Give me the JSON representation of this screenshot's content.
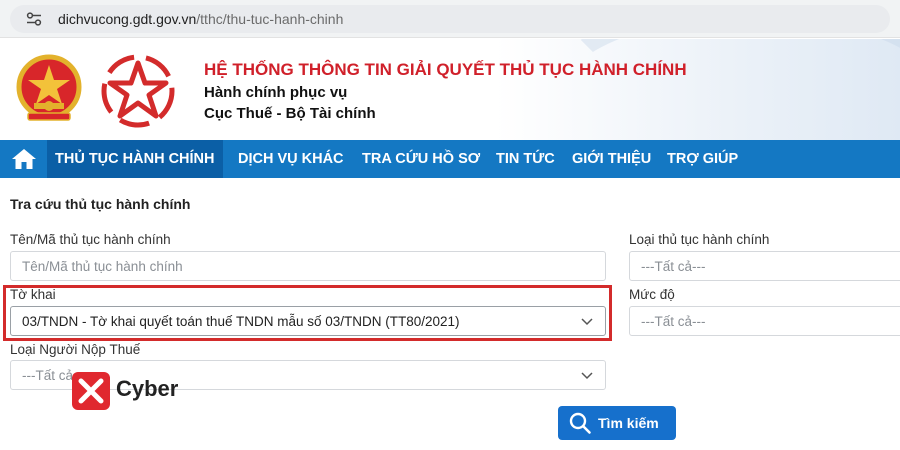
{
  "browser": {
    "url_domain": "dichvucong.gdt.gov.vn",
    "url_path": "/tthc/thu-tuc-hanh-chinh"
  },
  "header": {
    "system_title": "HỆ THỐNG THÔNG TIN GIẢI QUYẾT THỦ TỤC HÀNH CHÍNH",
    "subtitle_line1": "Hành chính phục vụ",
    "subtitle_line2": "Cục Thuế - Bộ Tài chính"
  },
  "nav": {
    "items": [
      {
        "label": "THỦ TỤC HÀNH CHÍNH",
        "active": true
      },
      {
        "label": "DỊCH VỤ KHÁC"
      },
      {
        "label": "TRA CỨU HỒ SƠ"
      },
      {
        "label": "TIN TỨC"
      },
      {
        "label": "GIỚI THIỆU"
      },
      {
        "label": "TRỢ GIÚP"
      }
    ]
  },
  "form": {
    "section_title": "Tra cứu thủ tục hành chính",
    "name_label": "Tên/Mã thủ tục hành chính",
    "name_placeholder": "Tên/Mã thủ tục hành chính",
    "form_label": "Tờ khai",
    "form_value": "03/TNDN - Tờ khai quyết toán thuế TNDN mẫu số 03/TNDN (TT80/2021)",
    "payer_label": "Loại Người Nộp Thuế",
    "payer_value": "---Tất cả---",
    "type_label": "Loại thủ tục hành chính",
    "type_value": "---Tất cả---",
    "level_label": "Mức độ",
    "level_value": "---Tất cả---",
    "search_label": "Tìm kiếm"
  },
  "watermark": {
    "text": "Cyber"
  },
  "colors": {
    "nav_bg": "#1478c3",
    "nav_active": "#0b5fa6",
    "title_red": "#d0202a",
    "highlight": "#d32b2b",
    "button": "#1670cc"
  }
}
